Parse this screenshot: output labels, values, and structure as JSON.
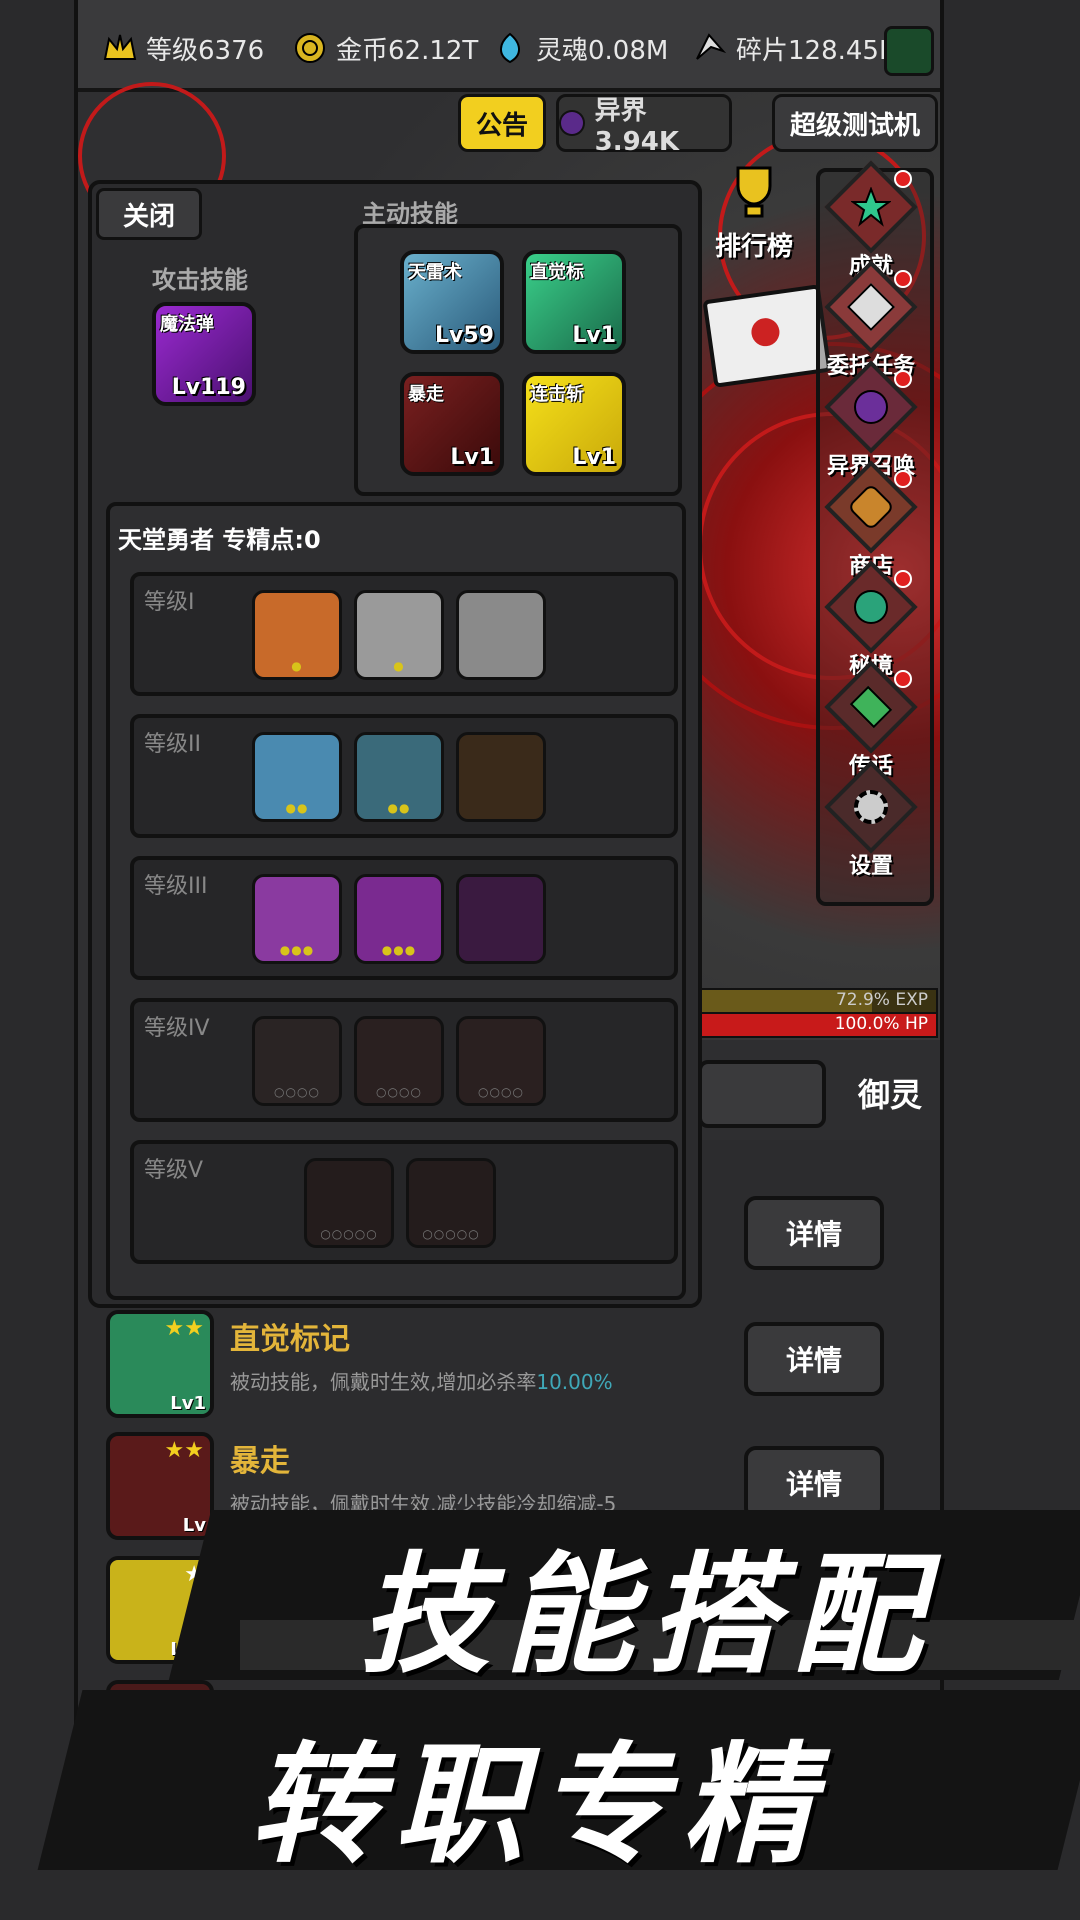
{
  "resources": {
    "level": "等级6376",
    "gold": "金币62.12T",
    "soul": "灵魂0.08M",
    "shards": "碎片128.45M"
  },
  "top_tabs": {
    "notice": "公告",
    "otherworld": "异界3.94K",
    "super_test": "超级测试机"
  },
  "side_menu": {
    "ranking": "排行榜",
    "achievement": "成就",
    "commission": "委托任务",
    "summon": "异界召唤",
    "shop": "商店",
    "secret": "秘境",
    "message": "传话",
    "settings": "设置"
  },
  "bars": {
    "exp": "72.9% EXP",
    "hp": "100.0% HP",
    "exp_fraction": 0.729,
    "hp_fraction": 1.0
  },
  "panel": {
    "close_label": "关闭",
    "attack_title": "攻击技能",
    "active_title": "主动技能",
    "attack_skill": {
      "name": "魔法弹",
      "level": "Lv119"
    },
    "active_skills": [
      {
        "name": "天雷术",
        "level": "Lv59"
      },
      {
        "name": "直觉标",
        "level": "Lv1"
      },
      {
        "name": "暴走",
        "level": "Lv1"
      },
      {
        "name": "连击斩",
        "level": "Lv1"
      }
    ],
    "class_title": "天堂勇者 专精点:0",
    "tiers": [
      {
        "label": "等级I",
        "count": 3
      },
      {
        "label": "等级II",
        "count": 3
      },
      {
        "label": "等级III",
        "count": 3
      },
      {
        "label": "等级IV",
        "count": 3
      },
      {
        "label": "等级V",
        "count": 2
      }
    ]
  },
  "bottom_tabs": {
    "yuling": "御灵"
  },
  "skill_list": [
    {
      "name": "直觉标记",
      "level": "Lv1",
      "desc": "被动技能，佩戴时生效,增加必杀率",
      "highlight": "10.00%",
      "button": "详情"
    },
    {
      "name": "暴走",
      "level": "Lv",
      "desc": "被动技能，佩戴时生效,减少技能冷却缩减-5",
      "highlight": "",
      "button": "详情"
    },
    {
      "name": "",
      "level": "Lv1",
      "desc": "",
      "highlight": "",
      "button": ""
    }
  ],
  "first_detail": "详情",
  "banner": {
    "line1": "技能搭配",
    "line2": "转职专精"
  },
  "colors": {
    "accent_yellow": "#f2cf1f",
    "skill_title": "#e3b53a",
    "hp_red": "#c81a1a",
    "exp_olive": "#6a5a1a"
  }
}
